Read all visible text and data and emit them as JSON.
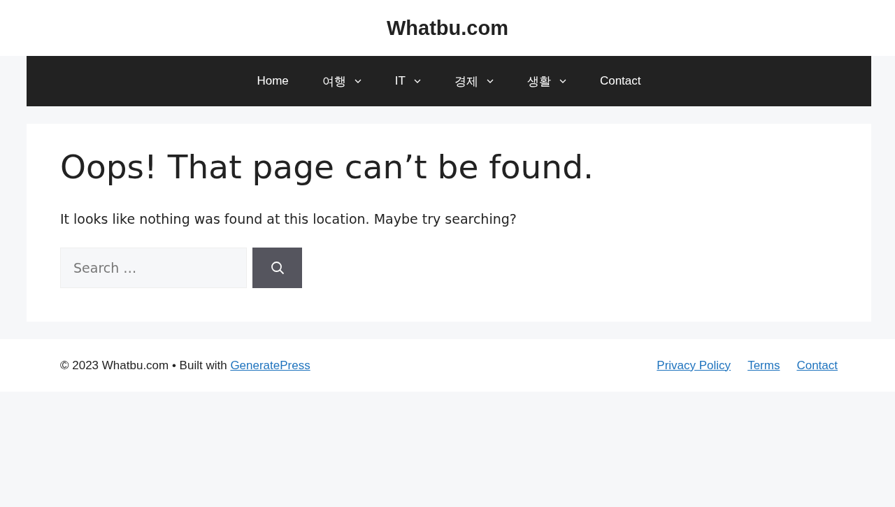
{
  "site_title": "Whatbu.com",
  "nav": [
    {
      "label": "Home",
      "has_submenu": false
    },
    {
      "label": "여행",
      "has_submenu": true
    },
    {
      "label": "IT",
      "has_submenu": true
    },
    {
      "label": "경제",
      "has_submenu": true
    },
    {
      "label": "생활",
      "has_submenu": true
    },
    {
      "label": "Contact",
      "has_submenu": false
    }
  ],
  "content": {
    "heading": "Oops! That page can’t be found.",
    "message": "It looks like nothing was found at this location. Maybe try searching?",
    "search": {
      "placeholder": "Search …"
    }
  },
  "footer": {
    "copyright": "© 2023 Whatbu.com • Built with",
    "credit_link": "GeneratePress",
    "links": [
      "Privacy Policy",
      "Terms",
      "Contact"
    ]
  }
}
